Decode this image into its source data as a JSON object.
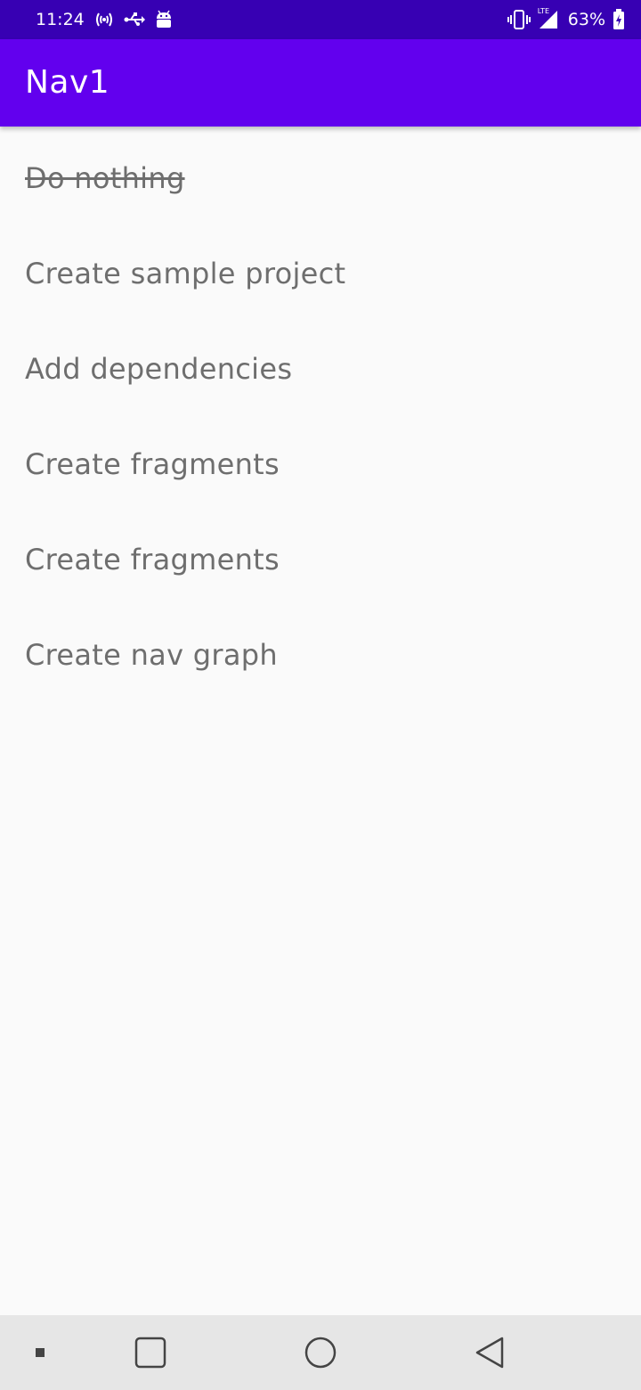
{
  "status_bar": {
    "time": "11:24",
    "battery_percent": "63%",
    "icons": [
      "hotspot-icon",
      "usb-icon",
      "android-debug-icon",
      "vibrate-icon",
      "lte-signal-icon",
      "battery-charging-icon"
    ],
    "lte_label": "LTE"
  },
  "app_bar": {
    "title": "Nav1",
    "color": "#6200ee",
    "status_color": "#3700b3"
  },
  "tasks": [
    {
      "label": "Do nothing",
      "done": true
    },
    {
      "label": "Create sample project",
      "done": false
    },
    {
      "label": "Add dependencies",
      "done": false
    },
    {
      "label": "Create fragments",
      "done": false
    },
    {
      "label": "Create fragments",
      "done": false
    },
    {
      "label": "Create nav graph",
      "done": false
    }
  ],
  "nav_bar": {
    "buttons": [
      "menu-dot-icon",
      "recents-icon",
      "home-icon",
      "back-icon"
    ]
  }
}
